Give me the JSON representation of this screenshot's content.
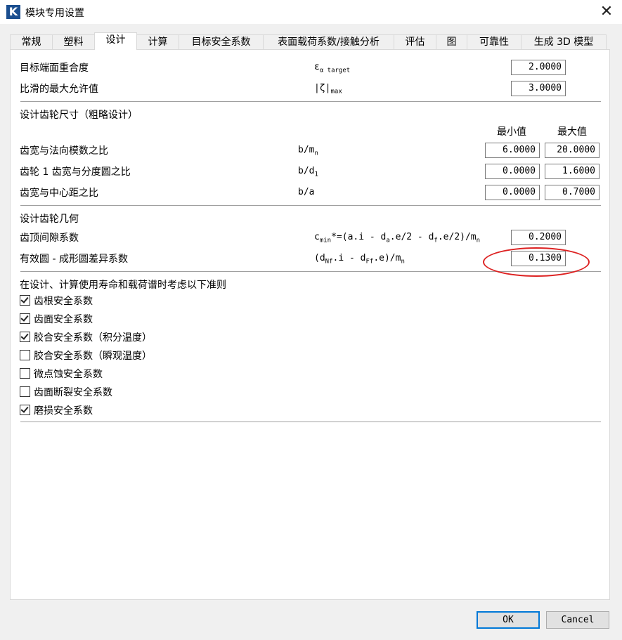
{
  "window": {
    "title": "模块专用设置",
    "app_icon": "K",
    "close": "✕"
  },
  "tabs": [
    {
      "label": "常规"
    },
    {
      "label": "塑料"
    },
    {
      "label": "设计"
    },
    {
      "label": "计算"
    },
    {
      "label": "目标安全系数"
    },
    {
      "label": "表面载荷系数/接触分析"
    },
    {
      "label": "评估"
    },
    {
      "label": "图"
    },
    {
      "label": "可靠性"
    },
    {
      "label": "生成 3D 模型"
    }
  ],
  "active_tab": "设计",
  "section1": {
    "rows": [
      {
        "label": "目标端面重合度",
        "symbol": "ε",
        "sub": "α target",
        "value": "2.0000"
      },
      {
        "label": "比滑的最大允许值",
        "symbol": "|ζ|",
        "sub": "max",
        "value": "3.0000"
      }
    ]
  },
  "section2": {
    "title": "设计齿轮尺寸（粗略设计）",
    "col_min": "最小值",
    "col_max": "最大值",
    "rows": [
      {
        "label": "齿宽与法向模数之比",
        "f1": "b/m",
        "fsub": "n",
        "min": "6.0000",
        "max": "20.0000"
      },
      {
        "label": "齿轮 1 齿宽与分度圆之比",
        "f1": "b/d",
        "fsub": "1",
        "min": "0.0000",
        "max": "1.6000"
      },
      {
        "label": "齿宽与中心距之比",
        "f1": "b/a",
        "fsub": "",
        "min": "0.0000",
        "max": "0.7000"
      }
    ]
  },
  "section3": {
    "title": "设计齿轮几何",
    "rows": [
      {
        "label": "齿顶间隙系数",
        "value": "0.2000"
      },
      {
        "label": "有效圆 - 成形圆差异系数",
        "value": "0.1300"
      }
    ]
  },
  "section4": {
    "title": "在设计、计算使用寿命和载荷谱时考虑以下准则",
    "checks": [
      {
        "label": "齿根安全系数",
        "checked": true
      },
      {
        "label": "齿面安全系数",
        "checked": true
      },
      {
        "label": "胶合安全系数（积分温度）",
        "checked": true
      },
      {
        "label": "胶合安全系数（瞬观温度）",
        "checked": false
      },
      {
        "label": "微点蚀安全系数",
        "checked": false
      },
      {
        "label": "齿面断裂安全系数",
        "checked": false
      },
      {
        "label": "磨损安全系数",
        "checked": true
      }
    ]
  },
  "buttons": {
    "ok": "OK",
    "cancel": "Cancel"
  },
  "colors": {
    "highlight": "#dd2222",
    "default_button_border": "#0078d7"
  }
}
